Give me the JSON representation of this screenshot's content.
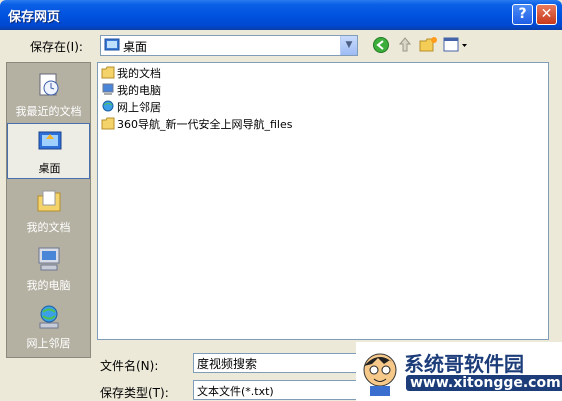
{
  "window": {
    "title": "保存网页",
    "help_label": "?",
    "close_label": "✕"
  },
  "save_in": {
    "label": "保存在(I):",
    "value": "桌面"
  },
  "places": [
    {
      "label": "我最近的文档",
      "icon": "recent-documents-icon"
    },
    {
      "label": "桌面",
      "icon": "desktop-icon"
    },
    {
      "label": "我的文档",
      "icon": "my-documents-icon"
    },
    {
      "label": "我的电脑",
      "icon": "my-computer-icon"
    },
    {
      "label": "网上邻居",
      "icon": "network-places-icon"
    }
  ],
  "files": [
    {
      "name": "我的文档",
      "icon": "my-documents-icon"
    },
    {
      "name": "我的电脑",
      "icon": "my-computer-icon"
    },
    {
      "name": "网上邻居",
      "icon": "network-places-icon"
    },
    {
      "name": "360导航_新一代安全上网导航_files",
      "icon": "folder-icon"
    }
  ],
  "filename": {
    "label": "文件名(N):",
    "value": "度视频搜索"
  },
  "filetype": {
    "label": "保存类型(T):",
    "value": "文本文件(*.txt)"
  },
  "watermark": {
    "title": "系统哥软件园",
    "url": "www.xitongge.com"
  },
  "colors": {
    "titlebar": "#0053e0",
    "dialog_bg": "#ece9d8",
    "places_bg": "#b4b1a3"
  }
}
